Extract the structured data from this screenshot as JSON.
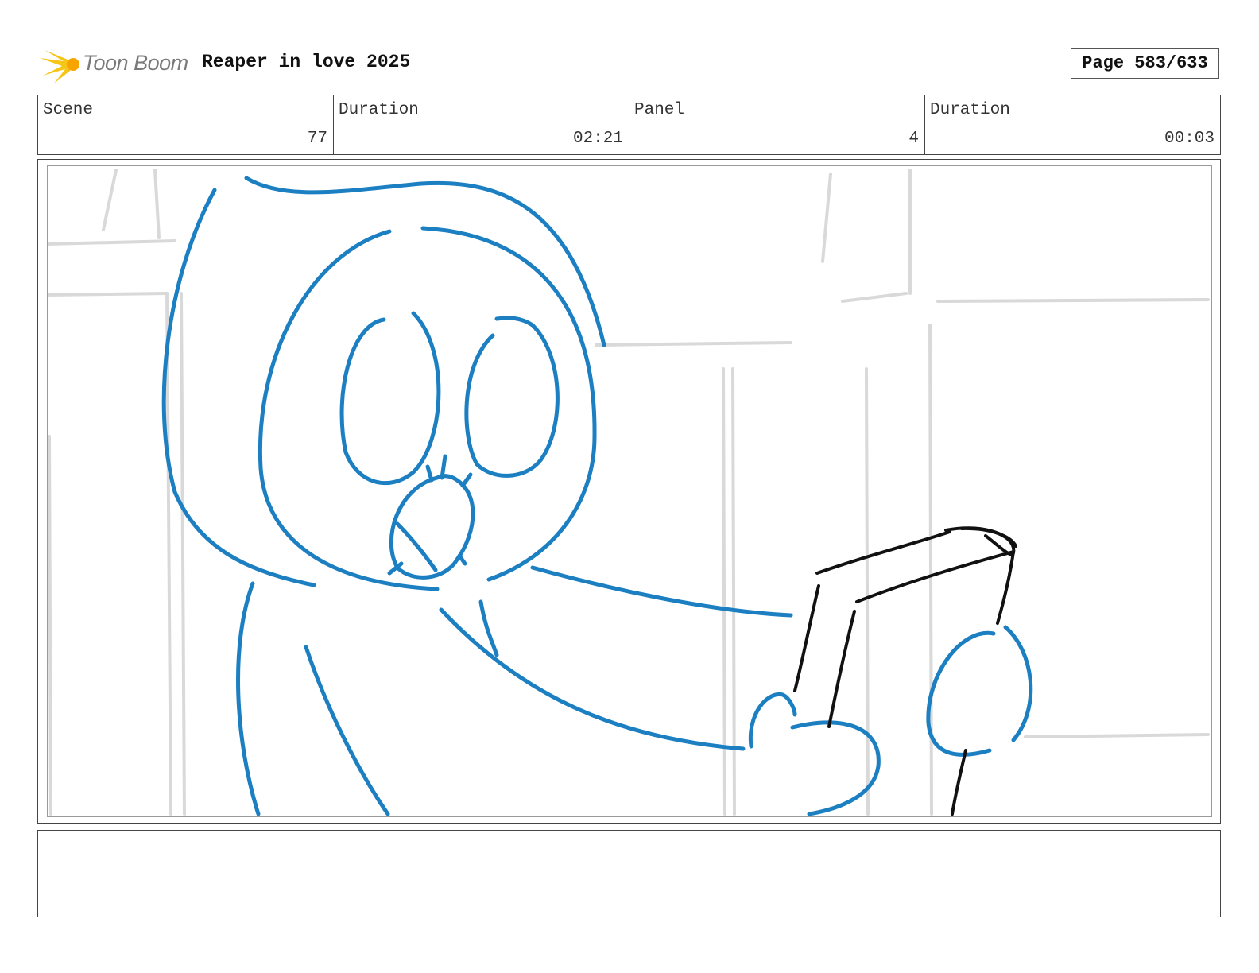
{
  "header": {
    "logo_text": "Toon Boom",
    "project_title": "Reaper in love 2025",
    "page_label": "Page 583/633"
  },
  "info": {
    "scene_label": "Scene",
    "scene_value": "77",
    "scene_duration_label": "Duration",
    "scene_duration_value": "02:21",
    "panel_label": "Panel",
    "panel_value": "4",
    "panel_duration_label": "Duration",
    "panel_duration_value": "00:03"
  },
  "colors": {
    "character_lines": "#1b7fc1",
    "phone_lines": "#111111",
    "background_lines": "#d9d9d9",
    "logo_star": "#f5c518"
  },
  "icons": {
    "logo": "toon-boom-star-icon"
  }
}
